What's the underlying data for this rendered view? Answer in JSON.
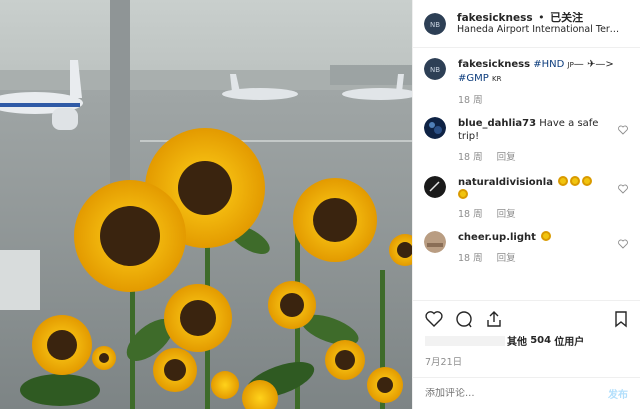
{
  "post": {
    "username": "fakesickness",
    "separator": "•",
    "follow_label": "已关注",
    "location": "Haneda Airport International Term..."
  },
  "caption": {
    "username": "fakesickness",
    "text_part1": "#HND",
    "jp": "JP",
    "arrow_text": "—",
    "arrow2": "—>",
    "text_part2": "#GMP",
    "kr": "KR",
    "time": "18 周"
  },
  "comments": [
    {
      "username": "blue_dahlia73",
      "text": "Have a safe trip!",
      "time": "18 周",
      "reply_label": "回复"
    },
    {
      "username": "naturaldivisionla",
      "text": "",
      "time": "18 周",
      "reply_label": "回复"
    },
    {
      "username": "cheer.up.light",
      "text": "",
      "time": "18 周",
      "reply_label": "回复"
    }
  ],
  "likes": {
    "other_label": "其他",
    "count": "504",
    "suffix": "位用户"
  },
  "date": "7月21日",
  "add_comment": {
    "placeholder": "添加评论...",
    "post_label": "发布"
  },
  "icons": {
    "like": "heart-icon",
    "comment": "comment-icon",
    "share": "share-icon",
    "save": "bookmark-icon"
  },
  "colors": {
    "link": "#0d3d7d",
    "muted": "#8e8e8e",
    "post_button": "#b2dffc"
  }
}
